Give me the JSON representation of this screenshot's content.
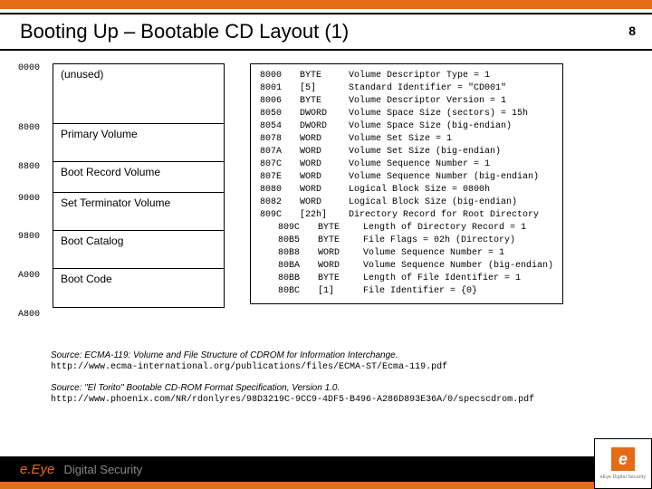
{
  "page_number": "8",
  "title": "Booting Up – Bootable CD Layout (1)",
  "layout": {
    "offsets": [
      "0000",
      "8000",
      "8800",
      "9000",
      "9800",
      "A000",
      "A800"
    ],
    "cells": [
      "(unused)",
      "Primary Volume",
      "Boot Record Volume",
      "Set Terminator Volume",
      "Boot Catalog",
      "Boot Code"
    ]
  },
  "dump": [
    {
      "indent": false,
      "off": "8000",
      "type": "BYTE",
      "desc": "Volume Descriptor Type = 1"
    },
    {
      "indent": false,
      "off": "8001",
      "type": "[5]",
      "desc": "Standard Identifier = \"CD001\""
    },
    {
      "indent": false,
      "off": "8006",
      "type": "BYTE",
      "desc": "Volume Descriptor Version = 1"
    },
    {
      "indent": false,
      "off": "8050",
      "type": "DWORD",
      "desc": "Volume Space Size (sectors) = 15h"
    },
    {
      "indent": false,
      "off": "8054",
      "type": "DWORD",
      "desc": "Volume Space Size (big-endian)"
    },
    {
      "indent": false,
      "off": "8078",
      "type": "WORD",
      "desc": "Volume Set Size = 1"
    },
    {
      "indent": false,
      "off": "807A",
      "type": "WORD",
      "desc": "Volume Set Size (big-endian)"
    },
    {
      "indent": false,
      "off": "807C",
      "type": "WORD",
      "desc": "Volume Sequence Number = 1"
    },
    {
      "indent": false,
      "off": "807E",
      "type": "WORD",
      "desc": "Volume Sequence Number (big-endian)"
    },
    {
      "indent": false,
      "off": "8080",
      "type": "WORD",
      "desc": "Logical Block Size = 0800h"
    },
    {
      "indent": false,
      "off": "8082",
      "type": "WORD",
      "desc": "Logical Block Size (big-endian)"
    },
    {
      "indent": false,
      "off": "809C",
      "type": "[22h]",
      "desc": "Directory Record for Root Directory"
    },
    {
      "indent": true,
      "off": "809C",
      "type": "BYTE",
      "desc": "Length of Directory Record = 1"
    },
    {
      "indent": true,
      "off": "80B5",
      "type": "BYTE",
      "desc": "File Flags = 02h (Directory)"
    },
    {
      "indent": true,
      "off": "80B8",
      "type": "WORD",
      "desc": "Volume Sequence Number = 1"
    },
    {
      "indent": true,
      "off": "80BA",
      "type": "WORD",
      "desc": "Volume Sequence Number (big-endian)"
    },
    {
      "indent": true,
      "off": "80BB",
      "type": "BYTE",
      "desc": "Length of File Identifier = 1"
    },
    {
      "indent": true,
      "off": "80BC",
      "type": "[1]",
      "desc": "File Identifier = {0}"
    }
  ],
  "sources": [
    {
      "label": "Source: ECMA-119: Volume and File Structure of CDROM for Information Interchange.",
      "url": "http://www.ecma-international.org/publications/files/ECMA-ST/Ecma-119.pdf"
    },
    {
      "label": "Source: \"El Torito\" Bootable CD-ROM Format Specification, Version 1.0.",
      "url": "http://www.phoenix.com/NR/rdonlyres/98D3219C-9CC9-4DF5-B496-A286D893E36A/0/specscdrom.pdf"
    }
  ],
  "brand": {
    "name_html": "e.Eye",
    "tag": "Digital Security",
    "small": "eEye Digital Security"
  }
}
